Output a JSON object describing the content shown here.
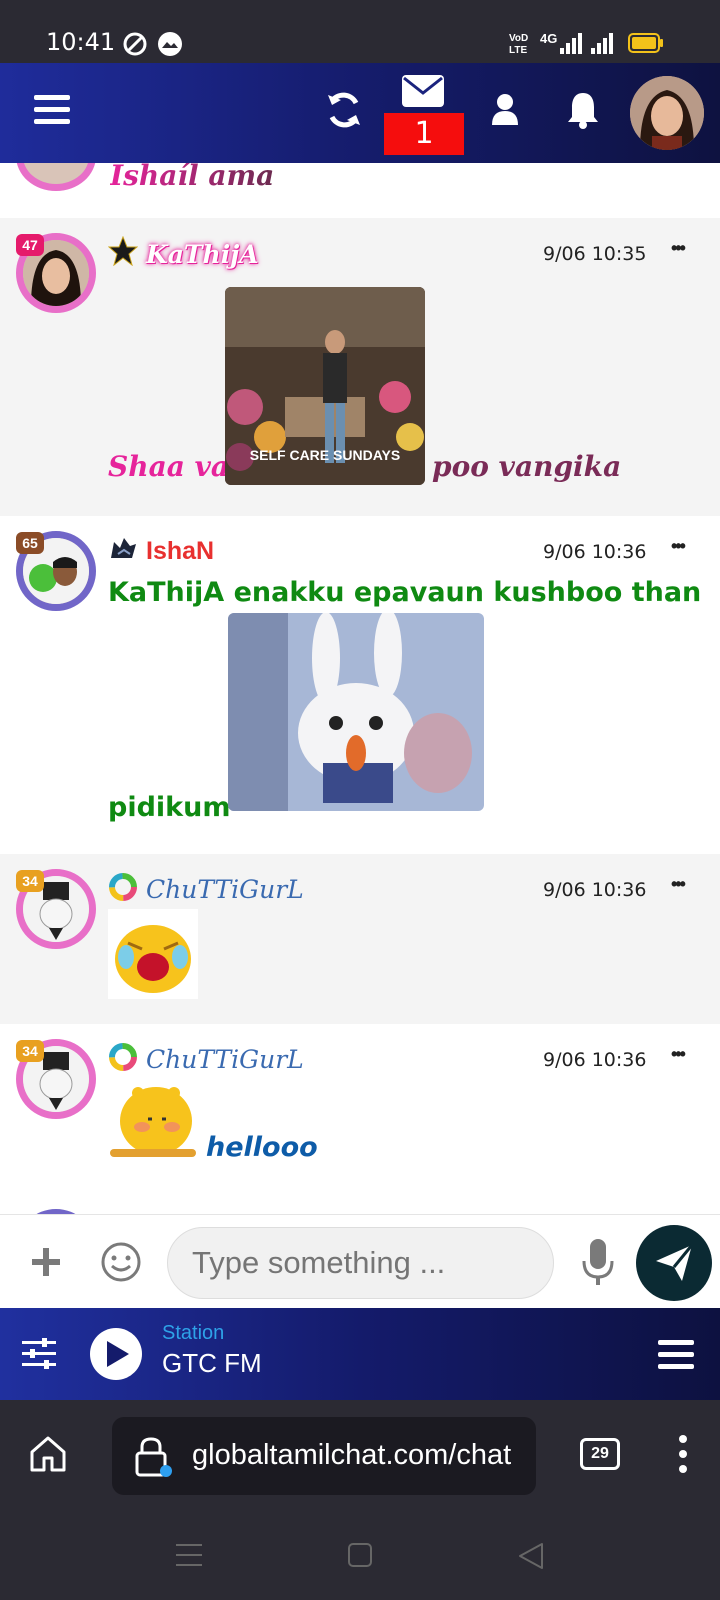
{
  "status_bar": {
    "time": "10:41",
    "network": "4G"
  },
  "topbar": {
    "mail_badge": "1"
  },
  "messages": [
    {
      "partial_text": "Ishaíl ama"
    },
    {
      "level": "47",
      "username": "KaThijA",
      "timestamp": "9/06 10:35",
      "text_before": "Shaa va",
      "gif_caption": "SELF CARE SUNDAYS",
      "text_after": "poo vangika"
    },
    {
      "level": "65",
      "username": "IshaN",
      "timestamp": "9/06 10:36",
      "text_line1": "KaThijA enakku epavaun kushboo than",
      "text_line2": "pidikum"
    },
    {
      "level": "34",
      "username": "ChuTTiGurL",
      "timestamp": "9/06 10:36"
    },
    {
      "level": "34",
      "username": "ChuTTiGurL",
      "timestamp": "9/06 10:36",
      "text": "hellooo"
    }
  ],
  "composer": {
    "placeholder": "Type something ..."
  },
  "player": {
    "station_label": "Station",
    "station_name": "GTC FM"
  },
  "browser": {
    "url": "globaltamilchat.com/chat",
    "tab_count": "29"
  },
  "colors": {
    "accent_pink": "#e6249b",
    "accent_green": "#0f8a12",
    "accent_blue": "#0e5ca8",
    "send_button": "#0b2a33"
  }
}
